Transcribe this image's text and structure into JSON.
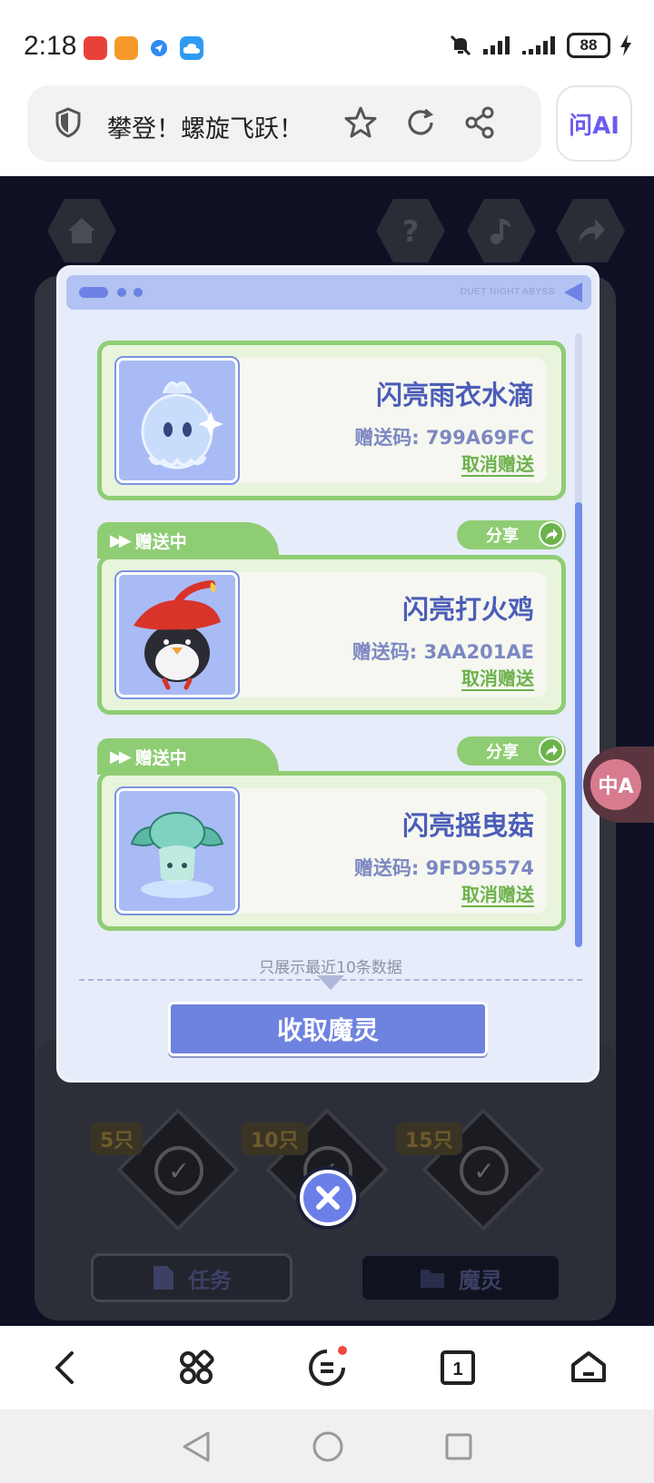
{
  "status_bar": {
    "time": "2:18",
    "battery": "88",
    "app_icons": [
      "huawei-store-icon",
      "orange-app-icon",
      "blue-app-icon",
      "cloud-icon"
    ],
    "right_icons": [
      "mute-bell-icon",
      "signal-icon",
      "signal-icon-2",
      "battery-icon",
      "charging-icon"
    ]
  },
  "browser": {
    "page_title": "攀登！螺旋飞跃！",
    "ai_label": "问AI"
  },
  "game": {
    "dialog": {
      "header_brand": "DUET NIGHT ABYSS",
      "items": [
        {
          "name": "闪亮雨衣水滴",
          "code": "赠送码: 799A69FC",
          "cancel_label": "取消赠送"
        },
        {
          "status_label": "赠送中",
          "share_label": "分享",
          "name": "闪亮打火鸡",
          "code": "赠送码: 3AA201AE",
          "cancel_label": "取消赠送"
        },
        {
          "status_label": "赠送中",
          "share_label": "分享",
          "name": "闪亮摇曳菇",
          "code": "赠送码: 9FD95574",
          "cancel_label": "取消赠送"
        }
      ],
      "note": "只展示最近10条数据",
      "collect_button": "收取魔灵"
    },
    "background": {
      "reward_counts": [
        "5只",
        "10只",
        "15只"
      ],
      "tabs": [
        "任务",
        "魔灵"
      ]
    },
    "translate_label": "中A"
  },
  "colors": {
    "accent_green": "#8fcd74",
    "accent_blue": "#6e82e0",
    "name_blue": "#4b5db8"
  }
}
